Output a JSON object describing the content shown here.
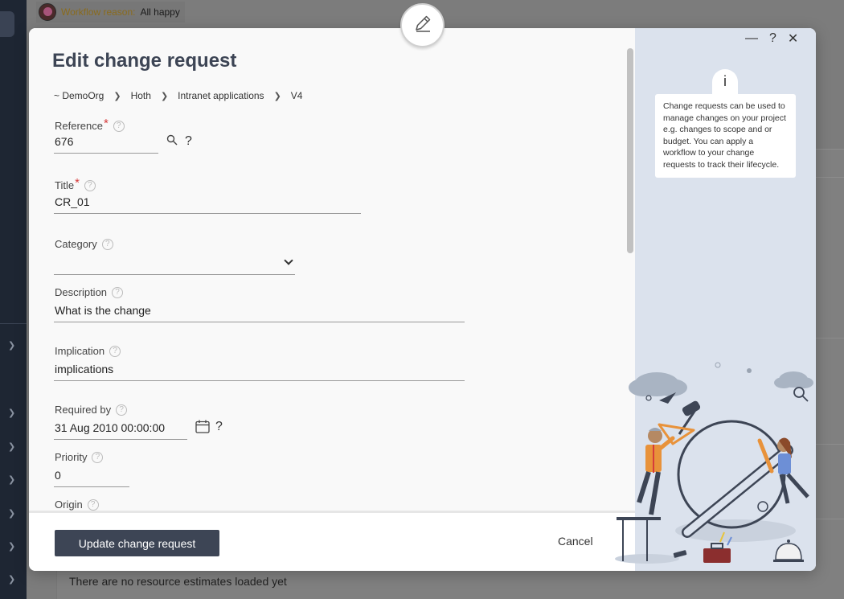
{
  "background": {
    "workflow_reason_label": "Workflow reason:",
    "workflow_reason_value": "All happy",
    "empty_estimates_text": "There are no resource estimates loaded yet"
  },
  "modal": {
    "title": "Edit change request",
    "breadcrumb": [
      "~ DemoOrg",
      "Hoth",
      "Intranet applications",
      "V4"
    ],
    "window_controls": {
      "minimize": "—",
      "help": "?",
      "close": "✕"
    },
    "fields": {
      "reference": {
        "label": "Reference",
        "value": "676"
      },
      "title": {
        "label": "Title",
        "value": "CR_01"
      },
      "category": {
        "label": "Category",
        "value": ""
      },
      "description": {
        "label": "Description",
        "value": "What is the change"
      },
      "implication": {
        "label": "Implication",
        "value": "implications"
      },
      "required_by": {
        "label": "Required by",
        "value": "31 Aug 2010 00:00:00"
      },
      "priority": {
        "label": "Priority",
        "value": "0"
      },
      "origin": {
        "label": "Origin"
      }
    },
    "help_mark": "?",
    "help_circle": "?",
    "footer": {
      "primary_label": "Update change request",
      "cancel_label": "Cancel"
    },
    "info_panel": {
      "icon": "i",
      "text": "Change requests can be used to manage changes on your project e.g. changes to scope and or budget. You can apply a workflow to your change requests to track their lifecycle."
    }
  },
  "colors": {
    "primary": "#3d4555",
    "required": "#d63b3b",
    "side_panel": "#dbe2ed",
    "accent_orange": "#e8923a"
  }
}
